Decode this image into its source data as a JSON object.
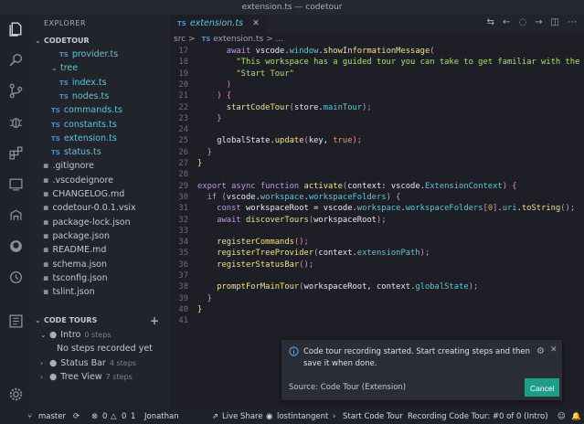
{
  "window": {
    "title": "extension.ts — codetour"
  },
  "sidebar": {
    "title": "EXPLORER",
    "project": "CODETOUR",
    "files": [
      {
        "name": "provider.ts",
        "ts": true,
        "indent": 3,
        "folder": false
      },
      {
        "name": "tree",
        "ts": false,
        "indent": 2,
        "folder": true
      },
      {
        "name": "index.ts",
        "ts": true,
        "indent": 3,
        "folder": false
      },
      {
        "name": "nodes.ts",
        "ts": true,
        "indent": 3,
        "folder": false
      },
      {
        "name": "commands.ts",
        "ts": true,
        "indent": 2,
        "folder": false
      },
      {
        "name": "constants.ts",
        "ts": true,
        "indent": 2,
        "folder": false
      },
      {
        "name": "extension.ts",
        "ts": true,
        "indent": 2,
        "folder": false
      },
      {
        "name": "status.ts",
        "ts": true,
        "indent": 2,
        "folder": false
      },
      {
        "name": ".gitignore",
        "ts": false,
        "indent": 1,
        "folder": false
      },
      {
        "name": ".vscodeignore",
        "ts": false,
        "indent": 1,
        "folder": false
      },
      {
        "name": "CHANGELOG.md",
        "ts": false,
        "indent": 1,
        "folder": false
      },
      {
        "name": "codetour-0.0.1.vsix",
        "ts": false,
        "indent": 1,
        "folder": false
      },
      {
        "name": "package-lock.json",
        "ts": false,
        "indent": 1,
        "folder": false
      },
      {
        "name": "package.json",
        "ts": false,
        "indent": 1,
        "folder": false
      },
      {
        "name": "README.md",
        "ts": false,
        "indent": 1,
        "folder": false
      },
      {
        "name": "schema.json",
        "ts": false,
        "indent": 1,
        "folder": false
      },
      {
        "name": "tsconfig.json",
        "ts": false,
        "indent": 1,
        "folder": false
      },
      {
        "name": "tslint.json",
        "ts": false,
        "indent": 1,
        "folder": false
      }
    ],
    "tours_title": "CODE TOURS",
    "tours": [
      {
        "name": "Intro",
        "meta": "0 steps"
      },
      {
        "name": "No steps recorded yet",
        "meta": ""
      },
      {
        "name": "Status Bar",
        "meta": "4 steps"
      },
      {
        "name": "Tree View",
        "meta": "7 steps"
      }
    ]
  },
  "editor": {
    "tab_label": "extension.ts",
    "breadcrumb": [
      "src",
      ">",
      "extension.ts",
      ">",
      "..."
    ],
    "lines": [
      {
        "n": "17",
        "tokens": [
          [
            "      ",
            ""
          ],
          [
            "await ",
            "kw"
          ],
          [
            "vscode",
            "var"
          ],
          [
            ".",
            "var"
          ],
          [
            "window",
            "prop"
          ],
          [
            ".",
            "var"
          ],
          [
            "showInformationMessage",
            "fn"
          ],
          [
            "(",
            "br"
          ]
        ]
      },
      {
        "n": "18",
        "tokens": [
          [
            "        ",
            ""
          ],
          [
            "\"This workspace has a guided tour you can take to get familiar with the",
            "str"
          ]
        ]
      },
      {
        "n": "19",
        "tokens": [
          [
            "        ",
            ""
          ],
          [
            "\"Start Tour\"",
            "str"
          ]
        ]
      },
      {
        "n": "20",
        "tokens": [
          [
            "      ",
            ""
          ],
          [
            ")",
            "br"
          ]
        ]
      },
      {
        "n": "21",
        "tokens": [
          [
            "    ",
            ""
          ],
          [
            ") {",
            "br"
          ]
        ]
      },
      {
        "n": "22",
        "tokens": [
          [
            "      ",
            ""
          ],
          [
            "startCodeTour",
            "fn"
          ],
          [
            "(",
            "br"
          ],
          [
            "store",
            "var"
          ],
          [
            ".",
            "var"
          ],
          [
            "mainTour",
            "prop"
          ],
          [
            ");",
            "br"
          ]
        ]
      },
      {
        "n": "23",
        "tokens": [
          [
            "    ",
            ""
          ],
          [
            "}",
            "br"
          ]
        ]
      },
      {
        "n": "24",
        "tokens": []
      },
      {
        "n": "25",
        "tokens": [
          [
            "    ",
            ""
          ],
          [
            "globalState",
            "var"
          ],
          [
            ".",
            "var"
          ],
          [
            "update",
            "fn"
          ],
          [
            "(",
            "br"
          ],
          [
            "key",
            "var"
          ],
          [
            ", ",
            "var"
          ],
          [
            "true",
            "num"
          ],
          [
            ");",
            "br"
          ]
        ]
      },
      {
        "n": "26",
        "tokens": [
          [
            "  ",
            ""
          ],
          [
            "}",
            "kw"
          ]
        ]
      },
      {
        "n": "27",
        "tokens": [
          [
            "}",
            "fn"
          ]
        ]
      },
      {
        "n": "28",
        "tokens": []
      },
      {
        "n": "29",
        "tokens": [
          [
            "export async function ",
            "kw"
          ],
          [
            "activate",
            "fn"
          ],
          [
            "(",
            "br"
          ],
          [
            "context",
            "var"
          ],
          [
            ": ",
            "var"
          ],
          [
            "vscode",
            "var"
          ],
          [
            ".",
            "var"
          ],
          [
            "ExtensionContext",
            "prop"
          ],
          [
            ") {",
            "br"
          ]
        ]
      },
      {
        "n": "30",
        "tokens": [
          [
            "  ",
            ""
          ],
          [
            "if ",
            "kw"
          ],
          [
            "(",
            "br"
          ],
          [
            "vscode",
            "var"
          ],
          [
            ".",
            "var"
          ],
          [
            "workspace",
            "prop"
          ],
          [
            ".",
            "var"
          ],
          [
            "workspaceFolders",
            "prop"
          ],
          [
            ") {",
            "br"
          ]
        ]
      },
      {
        "n": "31",
        "tokens": [
          [
            "    ",
            ""
          ],
          [
            "const ",
            "kw"
          ],
          [
            "workspaceRoot",
            "var"
          ],
          [
            " = ",
            "var"
          ],
          [
            "vscode",
            "var"
          ],
          [
            ".",
            "var"
          ],
          [
            "workspace",
            "prop"
          ],
          [
            ".",
            "var"
          ],
          [
            "workspaceFolders",
            "prop"
          ],
          [
            "[",
            "br"
          ],
          [
            "0",
            "num"
          ],
          [
            "]",
            "br"
          ],
          [
            ".",
            "var"
          ],
          [
            "uri",
            "prop"
          ],
          [
            ".",
            "var"
          ],
          [
            "toString",
            "fn"
          ],
          [
            "();",
            "br"
          ]
        ]
      },
      {
        "n": "32",
        "tokens": [
          [
            "    ",
            ""
          ],
          [
            "await ",
            "kw"
          ],
          [
            "discoverTours",
            "fn"
          ],
          [
            "(",
            "br"
          ],
          [
            "workspaceRoot",
            "var"
          ],
          [
            ");",
            "br"
          ]
        ]
      },
      {
        "n": "33",
        "tokens": []
      },
      {
        "n": "34",
        "tokens": [
          [
            "    ",
            ""
          ],
          [
            "registerCommands",
            "fn"
          ],
          [
            "();",
            "br"
          ]
        ]
      },
      {
        "n": "35",
        "tokens": [
          [
            "    ",
            ""
          ],
          [
            "registerTreeProvider",
            "fn"
          ],
          [
            "(",
            "br"
          ],
          [
            "context",
            "var"
          ],
          [
            ".",
            "var"
          ],
          [
            "extensionPath",
            "prop"
          ],
          [
            ");",
            "br"
          ]
        ]
      },
      {
        "n": "36",
        "tokens": [
          [
            "    ",
            ""
          ],
          [
            "registerStatusBar",
            "fn"
          ],
          [
            "();",
            "br"
          ]
        ]
      },
      {
        "n": "37",
        "tokens": []
      },
      {
        "n": "38",
        "tokens": [
          [
            "    ",
            ""
          ],
          [
            "promptForMainTour",
            "fn"
          ],
          [
            "(",
            "br"
          ],
          [
            "workspaceRoot",
            "var"
          ],
          [
            ", ",
            "var"
          ],
          [
            "context",
            "var"
          ],
          [
            ".",
            "var"
          ],
          [
            "globalState",
            "prop"
          ],
          [
            ");",
            "br"
          ]
        ]
      },
      {
        "n": "39",
        "tokens": [
          [
            "  ",
            ""
          ],
          [
            "}",
            "kw"
          ]
        ]
      },
      {
        "n": "40",
        "tokens": [
          [
            "}",
            "fn"
          ]
        ]
      },
      {
        "n": "41",
        "tokens": []
      }
    ]
  },
  "notification": {
    "message": "Code tour recording started. Start creating steps and then save it when done.",
    "source": "Source: Code Tour (Extension)",
    "cancel_label": "Cancel"
  },
  "statusbar": {
    "branch": "master",
    "errors": "0",
    "warnings": "0",
    "info": "1",
    "user": "Jonathan",
    "liveshare": "Live Share",
    "account": "lostintangent",
    "start_tour": "Start Code Tour",
    "recording": "Recording Code Tour: #0 of 0 (Intro)"
  }
}
